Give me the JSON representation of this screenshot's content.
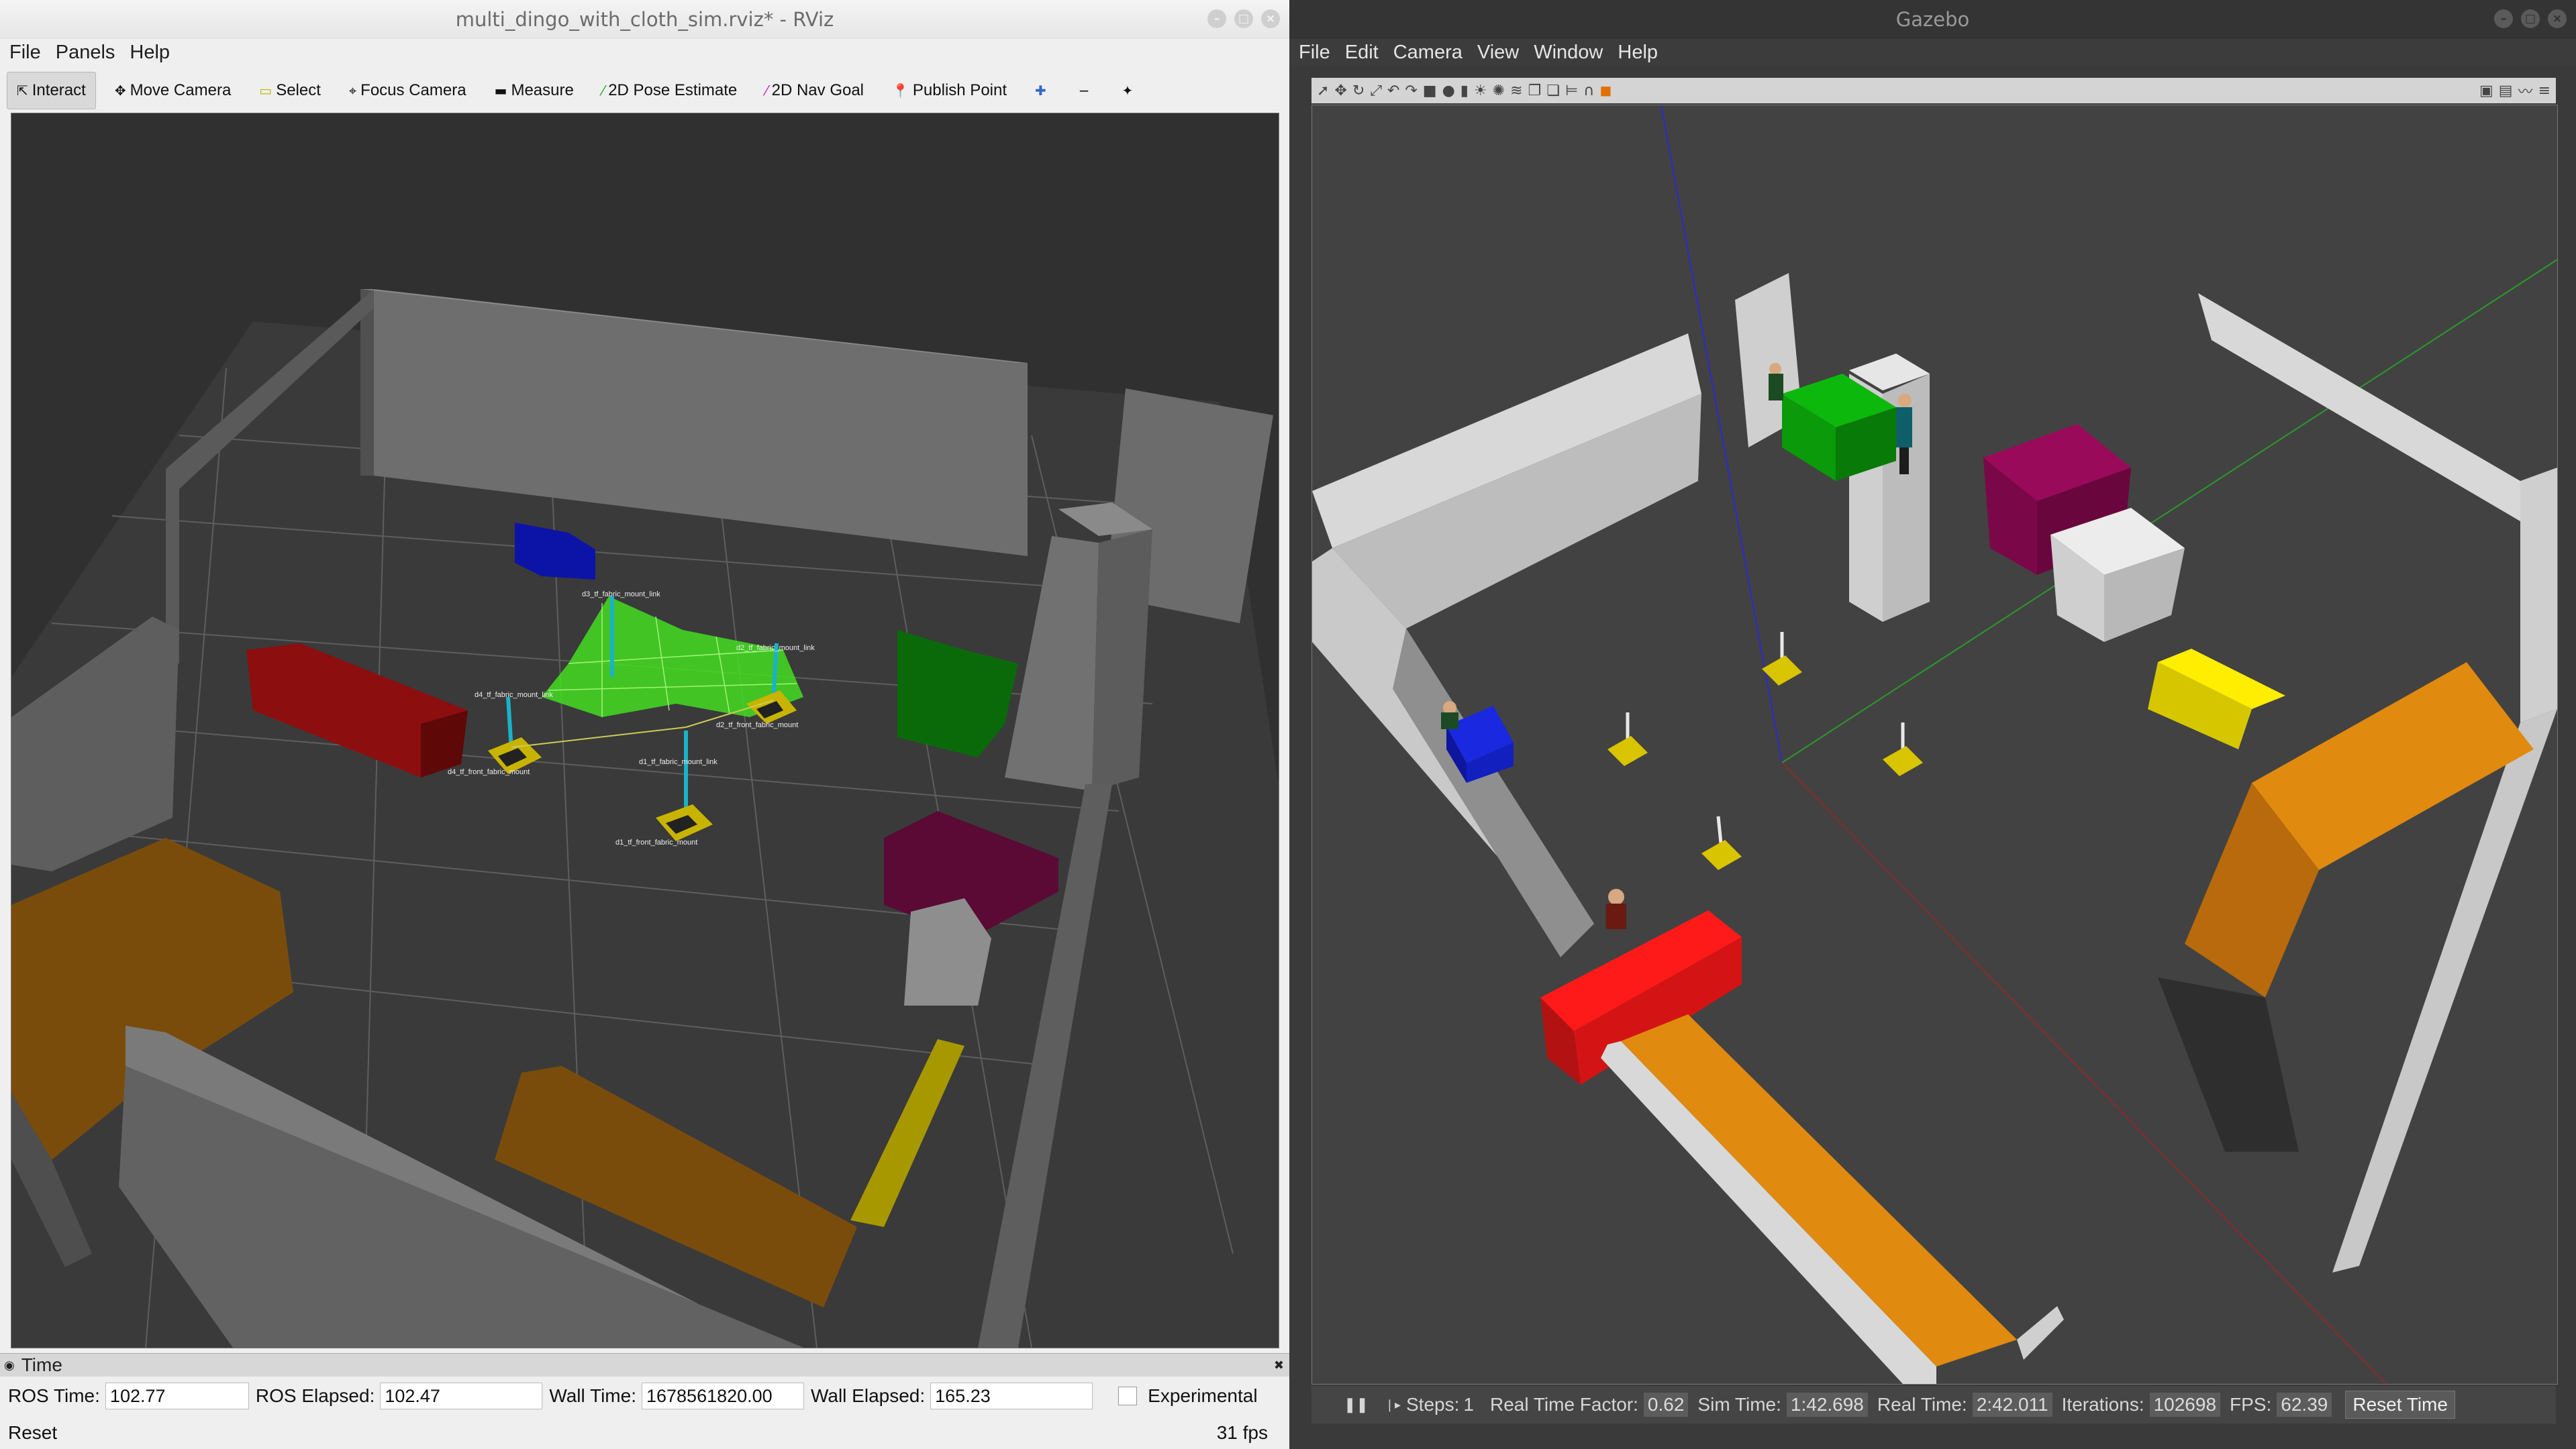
{
  "rviz": {
    "title": "multi_dingo_with_cloth_sim.rviz* - RViz",
    "menu": [
      "File",
      "Panels",
      "Help"
    ],
    "tools": [
      {
        "label": "Interact",
        "icon": "interact-icon",
        "active": true
      },
      {
        "label": "Move Camera",
        "icon": "move-camera-icon"
      },
      {
        "label": "Select",
        "icon": "select-icon"
      },
      {
        "label": "Focus Camera",
        "icon": "focus-camera-icon"
      },
      {
        "label": "Measure",
        "icon": "measure-icon"
      },
      {
        "label": "2D Pose Estimate",
        "icon": "pose-estimate-icon"
      },
      {
        "label": "2D Nav Goal",
        "icon": "nav-goal-icon"
      },
      {
        "label": "Publish Point",
        "icon": "publish-point-icon"
      }
    ],
    "frame_labels": {
      "d3_top": "d3_tf_fabric_mount_link",
      "d2_top": "d2_tf_fabric_mount_link",
      "d4_top": "d4_tf_fabric_mount_link",
      "d1_top": "d1_tf_fabric_mount_link",
      "d4_base": "d4_tf_front_fabric_mount",
      "d2_base": "d2_tf_front_fabric_mount",
      "d1_base": "d1_tf_front_fabric_mount"
    },
    "time_panel": {
      "title": "Time",
      "ros_time_label": "ROS Time:",
      "ros_time": "102.77",
      "ros_elapsed_label": "ROS Elapsed:",
      "ros_elapsed": "102.47",
      "wall_time_label": "Wall Time:",
      "wall_time": "1678561820.00",
      "wall_elapsed_label": "Wall Elapsed:",
      "wall_elapsed": "165.23",
      "experimental_label": "Experimental",
      "reset_label": "Reset",
      "fps": "31 fps"
    }
  },
  "gazebo": {
    "title": "Gazebo",
    "menu": [
      "File",
      "Edit",
      "Camera",
      "View",
      "Window",
      "Help"
    ],
    "status": {
      "steps_label": "Steps:",
      "steps_value": "1",
      "rtf_label": "Real Time Factor:",
      "rtf": "0.62",
      "sim_time_label": "Sim Time:",
      "sim_time": "1:42.698",
      "real_time_label": "Real Time:",
      "real_time": "2:42.011",
      "iterations_label": "Iterations:",
      "iterations": "102698",
      "fps_label": "FPS:",
      "fps": "62.39",
      "reset_time_label": "Reset Time"
    }
  },
  "colors": {
    "red_box": "#b31212",
    "blue_box": "#0c14a8",
    "green_box": "#0a8a0a",
    "maroon_box": "#6a0a3a",
    "orange_box": "#b06a0a",
    "yellow_box": "#b8a400",
    "cloth": "#55ff33"
  }
}
